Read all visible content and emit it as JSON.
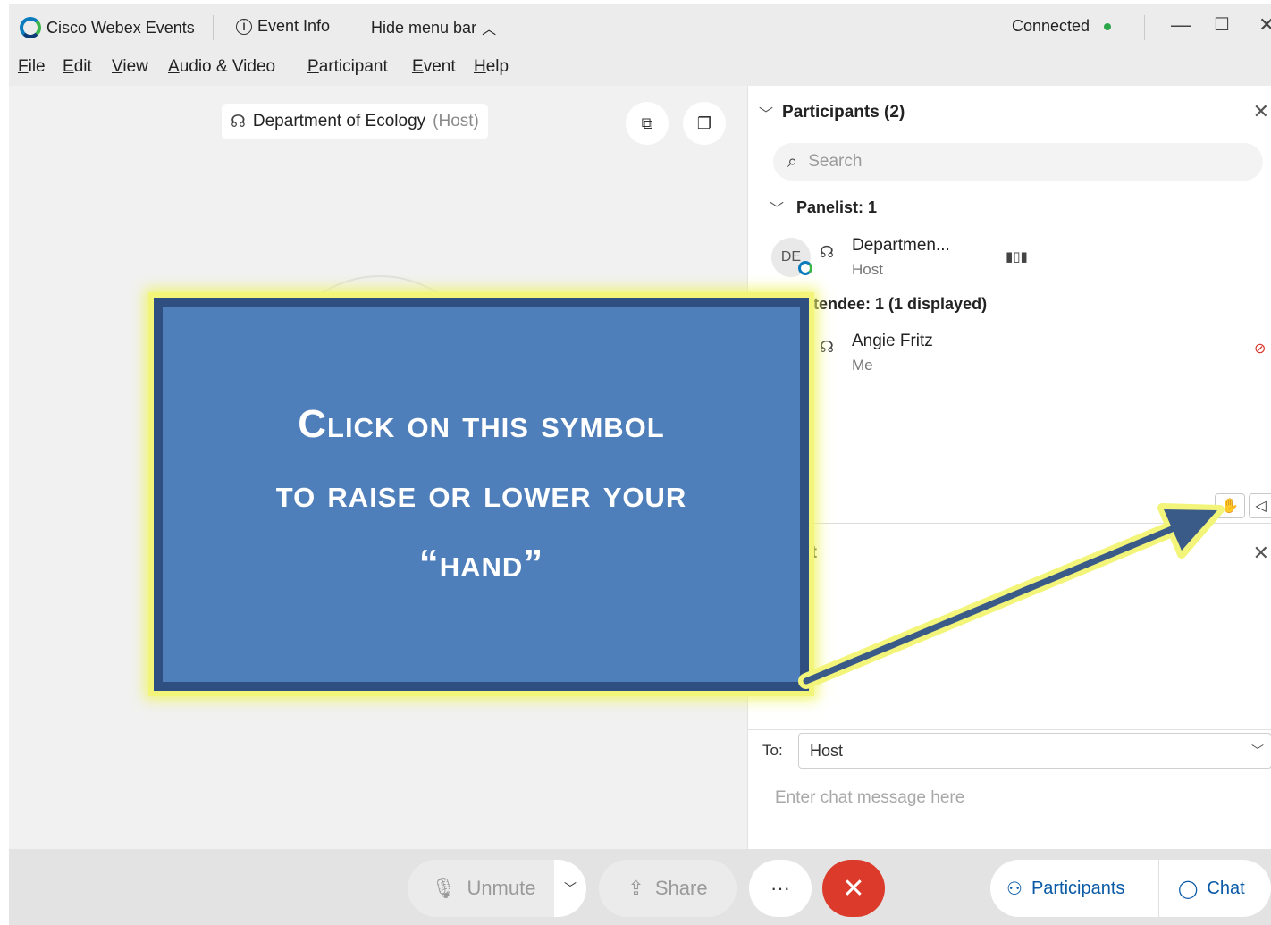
{
  "titlebar": {
    "app_name": "Cisco Webex Events",
    "event_info": "Event Info",
    "hide_menu": "Hide menu bar",
    "status": "Connected",
    "status_color": "#2ca64a"
  },
  "menu": [
    "File",
    "Edit",
    "View",
    "Audio & Video",
    "Participant",
    "Event",
    "Help"
  ],
  "stage": {
    "host_name": "Department of Ecology",
    "host_tag": "(Host)"
  },
  "participants": {
    "title": "Participants (2)",
    "search_placeholder": "Search",
    "panelist_header": "Panelist: 1",
    "attendee_header": "Attendee: 1 (1 displayed)",
    "panelist": {
      "initials": "DE",
      "name": "Departmen...",
      "role": "Host"
    },
    "attendee": {
      "name": "Angie Fritz",
      "role": "Me"
    }
  },
  "chat": {
    "title": "at",
    "to_label": "To:",
    "to_value": "Host",
    "input_placeholder": "Enter chat message here"
  },
  "controls": {
    "unmute": "Unmute",
    "share": "Share",
    "more": "···",
    "participants": "Participants",
    "chat": "Chat",
    "end_color": "#dc3a2a"
  },
  "callout": {
    "line1": "Click on this symbol",
    "line2": "to raise or lower your",
    "line3": "“hand”"
  }
}
